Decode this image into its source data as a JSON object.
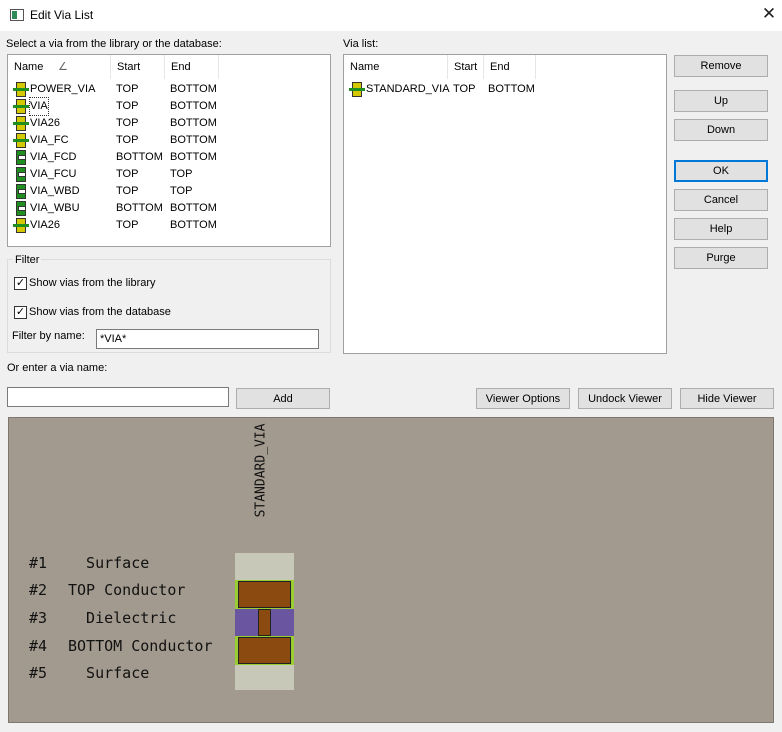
{
  "window": {
    "title": "Edit Via List",
    "close_glyph": "✕"
  },
  "library": {
    "label": "Select a via from the library or the database:",
    "columns": {
      "name": "Name",
      "start": "Start",
      "end": "End"
    },
    "rows": [
      {
        "name": "POWER_VIA",
        "start": "TOP",
        "end": "BOTTOM",
        "icon": "via-through-icon"
      },
      {
        "name": "VIA",
        "start": "TOP",
        "end": "BOTTOM",
        "icon": "via-through-icon"
      },
      {
        "name": "VIA26",
        "start": "TOP",
        "end": "BOTTOM",
        "icon": "via-through-icon"
      },
      {
        "name": "VIA_FC",
        "start": "TOP",
        "end": "BOTTOM",
        "icon": "via-through-icon"
      },
      {
        "name": "VIA_FCD",
        "start": "BOTTOM",
        "end": "BOTTOM",
        "icon": "via-blind-icon"
      },
      {
        "name": "VIA_FCU",
        "start": "TOP",
        "end": "TOP",
        "icon": "via-blind-icon"
      },
      {
        "name": "VIA_WBD",
        "start": "TOP",
        "end": "TOP",
        "icon": "via-blind-icon"
      },
      {
        "name": "VIA_WBU",
        "start": "BOTTOM",
        "end": "BOTTOM",
        "icon": "via-blind-icon"
      },
      {
        "name": "VIA26",
        "start": "TOP",
        "end": "BOTTOM",
        "icon": "via-through-icon"
      }
    ]
  },
  "filter": {
    "group_label": "Filter",
    "show_library": "Show vias from the library",
    "show_library_checked": true,
    "show_database": "Show vias from the database",
    "show_database_checked": true,
    "by_name_label": "Filter by name:",
    "by_name_value": "*VIA*"
  },
  "via_list": {
    "label": "Via list:",
    "columns": {
      "name": "Name",
      "start": "Start",
      "end": "End"
    },
    "rows": [
      {
        "name": "STANDARD_VIA",
        "start": "TOP",
        "end": "BOTTOM",
        "icon": "via-through-icon"
      }
    ]
  },
  "buttons": {
    "remove": "Remove",
    "up": "Up",
    "down": "Down",
    "ok": "OK",
    "cancel": "Cancel",
    "help": "Help",
    "purge": "Purge",
    "add": "Add",
    "viewer_options": "Viewer Options",
    "undock_viewer": "Undock Viewer",
    "hide_viewer": "Hide Viewer"
  },
  "enter_via": {
    "label": "Or enter a via name:",
    "value": ""
  },
  "viewer": {
    "via_name": "STANDARD_VIA",
    "layers": [
      {
        "num": "#1",
        "name": "  Surface"
      },
      {
        "num": "#2",
        "name": "TOP Conductor"
      },
      {
        "num": "#3",
        "name": "  Dielectric"
      },
      {
        "num": "#4",
        "name": "BOTTOM Conductor"
      },
      {
        "num": "#5",
        "name": "  Surface"
      }
    ],
    "colors": {
      "background": "#a29a8e",
      "surface": "#c8c8b8",
      "conductor": "#8b4a10",
      "dielectric": "#6a55a0",
      "edge": "#9acd32"
    }
  },
  "sort_indicator": "∠",
  "check_glyph": "✓"
}
